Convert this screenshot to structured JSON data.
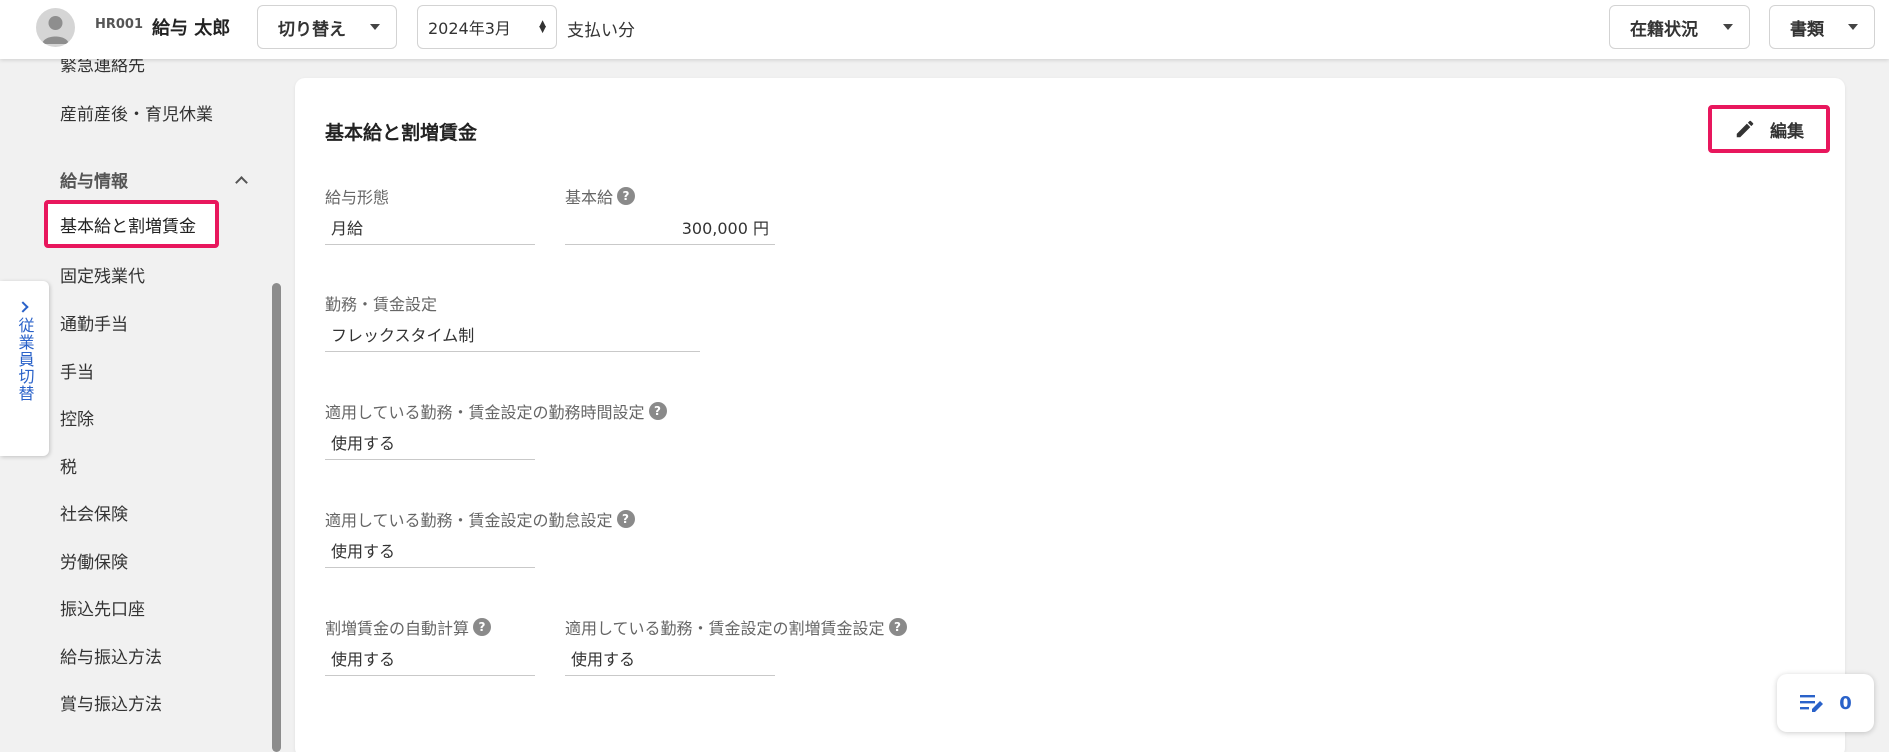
{
  "header": {
    "employee_code": "HR001",
    "employee_name": "給与 太郎",
    "switch_label": "切り替え",
    "month_value": "2024年3月",
    "pay_label": "支払い分",
    "status_label": "在籍状況",
    "docs_label": "書類"
  },
  "sidebar": {
    "items_top": [
      "緊急連絡先",
      "産前産後・育児休業"
    ],
    "section_label": "給与情報",
    "active_item": "基本給と割増賃金",
    "items": [
      "固定残業代",
      "通勤手当",
      "手当",
      "控除",
      "税",
      "社会保険",
      "労働保険",
      "振込先口座",
      "給与振込方法",
      "賞与振込方法"
    ],
    "employee_switch_tab": "従業員切替"
  },
  "main": {
    "title": "基本給と割増賃金",
    "edit_label": "編集",
    "fields": {
      "pay_type_label": "給与形態",
      "pay_type_value": "月給",
      "base_salary_label": "基本給",
      "base_salary_value": "300,000 円",
      "work_setting_label": "勤務・賃金設定",
      "work_setting_value": "フレックスタイム制",
      "work_hours_label": "適用している勤務・賃金設定の勤務時間設定",
      "work_hours_value": "使用する",
      "attendance_label": "適用している勤務・賃金設定の勤怠設定",
      "attendance_value": "使用する",
      "auto_calc_label": "割増賃金の自動計算",
      "auto_calc_value": "使用する",
      "premium_setting_label": "適用している勤務・賃金設定の割増賃金設定",
      "premium_setting_value": "使用する"
    }
  },
  "fab": {
    "count": "0"
  },
  "colors": {
    "highlight": "#e8175d",
    "accent": "#2a62c9"
  },
  "icons": [
    "avatar-icon",
    "caret-down-icon",
    "chevron-up-icon",
    "chevron-right-icon",
    "pencil-icon",
    "help-icon",
    "list-edit-icon"
  ]
}
